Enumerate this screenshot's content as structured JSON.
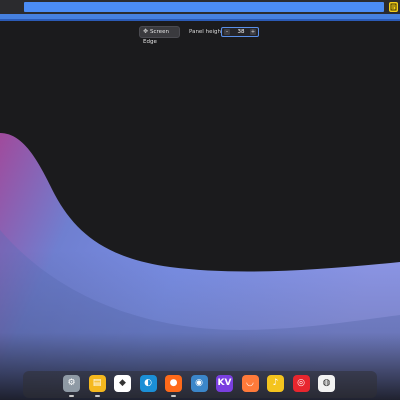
{
  "top_panel": {
    "tray_icon": "notes-icon"
  },
  "toolbar": {
    "screen_edge_label": "Screen Edge",
    "panel_height_label": "Panel height:",
    "panel_height_value": "38",
    "decrease_icon": "minus-icon",
    "increase_icon": "plus-icon"
  },
  "dock": {
    "items": [
      {
        "icon": "system-settings-icon",
        "color": "#8f9aa5",
        "running": true
      },
      {
        "icon": "file-manager-icon",
        "color": "#f5b81e",
        "running": true
      },
      {
        "icon": "inkscape-icon",
        "color": "#ffffff",
        "running": false
      },
      {
        "icon": "edge-browser-icon",
        "color": "#1b8fd6",
        "running": false
      },
      {
        "icon": "firefox-icon",
        "color": "#ff6a1a",
        "running": true
      },
      {
        "icon": "github-desktop-icon",
        "color": "#3b86c9",
        "running": false
      },
      {
        "icon": "kv-app-icon",
        "glyph": "KV",
        "color": "#7a3fe0",
        "running": false
      },
      {
        "icon": "shopping-bag-icon",
        "color": "#ff7a3a",
        "running": false
      },
      {
        "icon": "music-icon",
        "color": "#f4c41e",
        "running": false
      },
      {
        "icon": "netease-music-icon",
        "color": "#e8262e",
        "running": false
      },
      {
        "icon": "chrome-icon",
        "color": "#f2f2f2",
        "running": false
      }
    ]
  }
}
